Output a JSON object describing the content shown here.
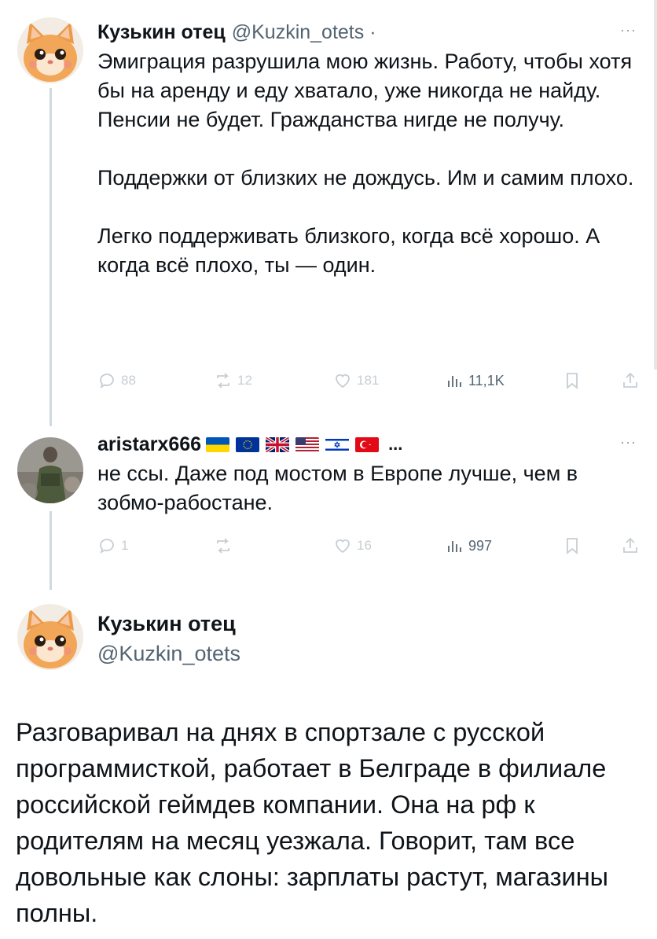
{
  "tweets": [
    {
      "author": "Кузькин отец",
      "handle": "@Kuzkin_otets ·",
      "more": "···",
      "paragraphs": [
        "Эмиграция разрушила мою жизнь. Работу, чтобы хотя бы на аренду и еду хватало, уже никогда не найду. Пенсии не будет. Гражданства нигде не получу.",
        "Поддержки от близких не дождусь. Им и самим плохо.",
        "Легко поддерживать близкого, когда всё хорошо. А когда всё плохо, ты — один."
      ],
      "stats": {
        "replies": "88",
        "retweets": "12",
        "likes": "181",
        "views": "11,1K"
      }
    },
    {
      "author": "aristarx666",
      "flags": [
        "ukraine-flag",
        "eu-flag",
        "uk-flag",
        "usa-flag",
        "israel-flag",
        "turkey-flag"
      ],
      "ellipsis": "...",
      "more": "···",
      "paragraphs": [
        "не ссы. Даже под мостом в Европе лучше, чем в зобмо-рабостане."
      ],
      "stats": {
        "replies": "1",
        "retweets": "",
        "likes": "16",
        "views": "997"
      }
    }
  ],
  "main_tweet": {
    "author": "Кузькин отец",
    "handle": "@Kuzkin_otets",
    "text": "Разговаривал на днях в спортзале с русской программисткой, работает в Белграде в филиале российской геймдев компании. Она на рф к родителям на месяц уезжала. Говорит, там все довольные как слоны: зарплаты растут, магазины полны."
  },
  "colors": {
    "text": "#0f1419",
    "secondary": "#536471",
    "faded_icons": "#c7ced3",
    "thread_line": "#cfd9de"
  }
}
